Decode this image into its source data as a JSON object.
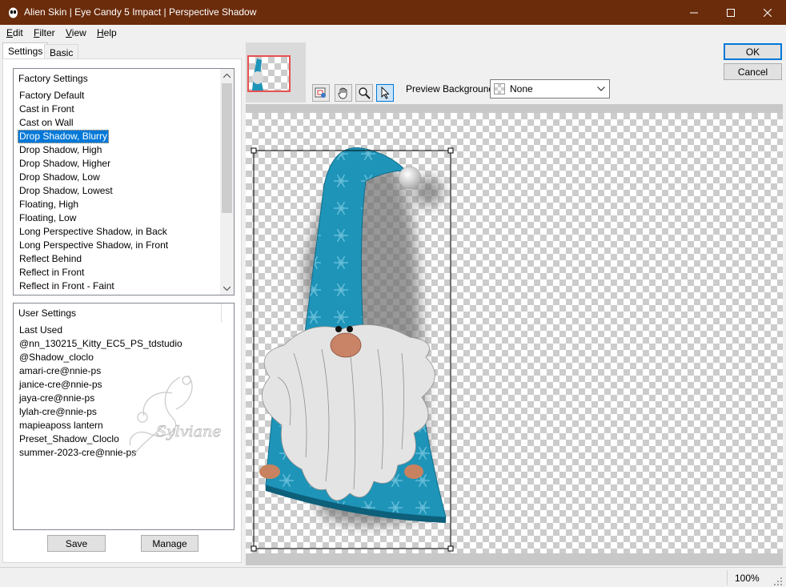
{
  "window": {
    "title": "Alien Skin | Eye Candy 5 Impact | Perspective Shadow",
    "minimize_icon": "minimize-icon",
    "maximize_icon": "maximize-icon",
    "close_icon": "close-icon"
  },
  "menu": [
    "Edit",
    "Filter",
    "View",
    "Help"
  ],
  "tabs": {
    "settings": "Settings",
    "basic": "Basic"
  },
  "factory_settings": {
    "header": "Factory Settings",
    "items": [
      "Factory Default",
      "Cast in Front",
      "Cast on Wall",
      "Drop Shadow, Blurry",
      "Drop Shadow, High",
      "Drop Shadow, Higher",
      "Drop Shadow, Low",
      "Drop Shadow, Lowest",
      "Floating, High",
      "Floating, Low",
      "Long Perspective Shadow, in Back",
      "Long Perspective Shadow, in Front",
      "Reflect Behind",
      "Reflect in Front",
      "Reflect in Front - Faint"
    ],
    "selected": "Drop Shadow, Blurry"
  },
  "user_settings": {
    "header": "User Settings",
    "items": [
      "Last Used",
      "@nn_130215_Kitty_EC5_PS_tdstudio",
      "@Shadow_cloclo",
      "amari-cre@nnie-ps",
      "janice-cre@nnie-ps",
      "jaya-cre@nnie-ps",
      "lylah-cre@nnie-ps",
      "mapieaposs lantern",
      "Preset_Shadow_Cloclo",
      "summer-2023-cre@nnie-ps"
    ],
    "watermark": "Sylviane"
  },
  "buttons": {
    "save": "Save",
    "manage": "Manage",
    "ok": "OK",
    "cancel": "Cancel"
  },
  "toolbar": {
    "icons": [
      "navigator-icon",
      "hand-icon",
      "zoom-icon",
      "pointer-icon"
    ],
    "preview_bg_label": "Preview Background:",
    "preview_bg_value": "None"
  },
  "status": {
    "zoom": "100%"
  },
  "colors": {
    "titlebar": "#6b2c0c",
    "selection": "#0078d7",
    "gnome_blue": "#1e94b8"
  }
}
